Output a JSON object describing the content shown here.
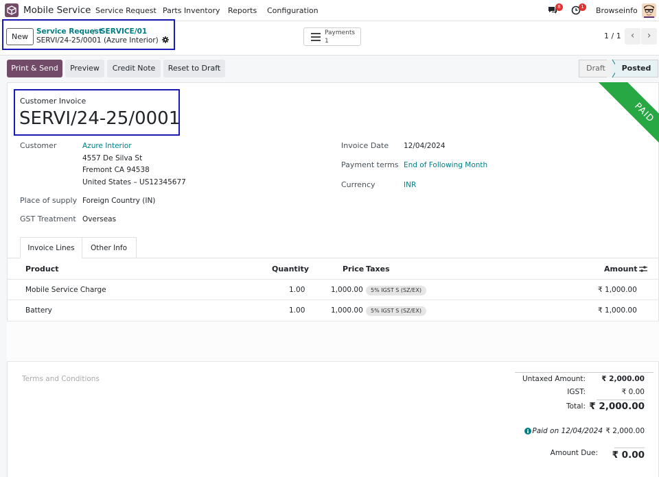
{
  "navbar": {
    "app_name": "Mobile Service",
    "menu": [
      "Service Request",
      "Parts Inventory",
      "Reports",
      "Configuration"
    ],
    "messages_count": "8",
    "activities_count": "1",
    "user_name": "Browseinfo"
  },
  "control": {
    "new_label": "New",
    "breadcrumb": [
      "Service Request",
      "SERVICE/01"
    ],
    "breadcrumb_sep": "/",
    "current_record": "SERVI/24-25/0001 (Azure Interior)",
    "payments_label": "Payments",
    "payments_count": "1",
    "pager": "1 / 1"
  },
  "actions": {
    "print_send": "Print & Send",
    "preview": "Preview",
    "credit_note": "Credit Note",
    "reset_draft": "Reset to Draft"
  },
  "status": {
    "draft": "Draft",
    "posted": "Posted"
  },
  "ribbon": "PAID",
  "invoice": {
    "type": "Customer Invoice",
    "number": "SERVI/24-25/0001",
    "customer_label": "Customer",
    "customer_name": "Azure Interior",
    "address_line1": "4557 De Silva St",
    "address_line2": "Fremont CA 94538",
    "address_line3": "United States – US12345677",
    "place_label": "Place of supply",
    "place_value": "Foreign Country (IN)",
    "gst_label": "GST Treatment",
    "gst_value": "Overseas",
    "date_label": "Invoice Date",
    "date_value": "12/04/2024",
    "terms_label": "Payment terms",
    "terms_value": "End of Following Month",
    "currency_label": "Currency",
    "currency_value": "INR"
  },
  "tabs": [
    "Invoice Lines",
    "Other Info"
  ],
  "table": {
    "headers": {
      "product": "Product",
      "quantity": "Quantity",
      "price": "Price",
      "taxes": "Taxes",
      "amount": "Amount"
    },
    "rows": [
      {
        "product": "Mobile Service Charge",
        "quantity": "1.00",
        "price": "1,000.00",
        "tax": "5% IGST S (SZ/EX)",
        "amount": "₹ 1,000.00"
      },
      {
        "product": "Battery",
        "quantity": "1.00",
        "price": "1,000.00",
        "tax": "5% IGST S (SZ/EX)",
        "amount": "₹ 1,000.00"
      }
    ]
  },
  "terms_placeholder": "Terms and Conditions",
  "totals": {
    "untaxed_label": "Untaxed Amount:",
    "untaxed_value": "₹ 2,000.00",
    "igst_label": "IGST:",
    "igst_value": "₹ 0.00",
    "total_label": "Total:",
    "total_value": "₹ 2,000.00",
    "paid_text": "Paid on 12/04/2024",
    "paid_value": "₹ 2,000.00",
    "due_label": "Amount Due:",
    "due_value": "₹ 0.00"
  },
  "colors": {
    "brand": "#714b67",
    "link": "#017e84",
    "paid_ribbon": "#28a745",
    "highlight_box": "#1a1ab8"
  }
}
